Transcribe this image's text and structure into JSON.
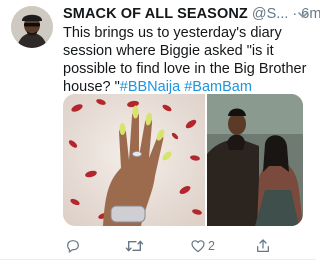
{
  "tweet": {
    "author_name": "SMACK OF ALL SEASONZ",
    "author_handle": "@S...",
    "separator": "·",
    "time": "6m",
    "text_plain": "This brings us to yesterday's diary session where Biggie asked \"is it possible to find love in the Big Brother house? \"",
    "hashtags": [
      "#BBNaija",
      "#BamBam"
    ]
  },
  "actions": {
    "reply_count": "",
    "retweet_count": "",
    "like_count": "2"
  },
  "colors": {
    "link": "#1b95e0",
    "muted": "#657786"
  },
  "icons": [
    "avatar",
    "chevron-down-icon",
    "reply-icon",
    "retweet-icon",
    "like-icon",
    "share-icon"
  ]
}
